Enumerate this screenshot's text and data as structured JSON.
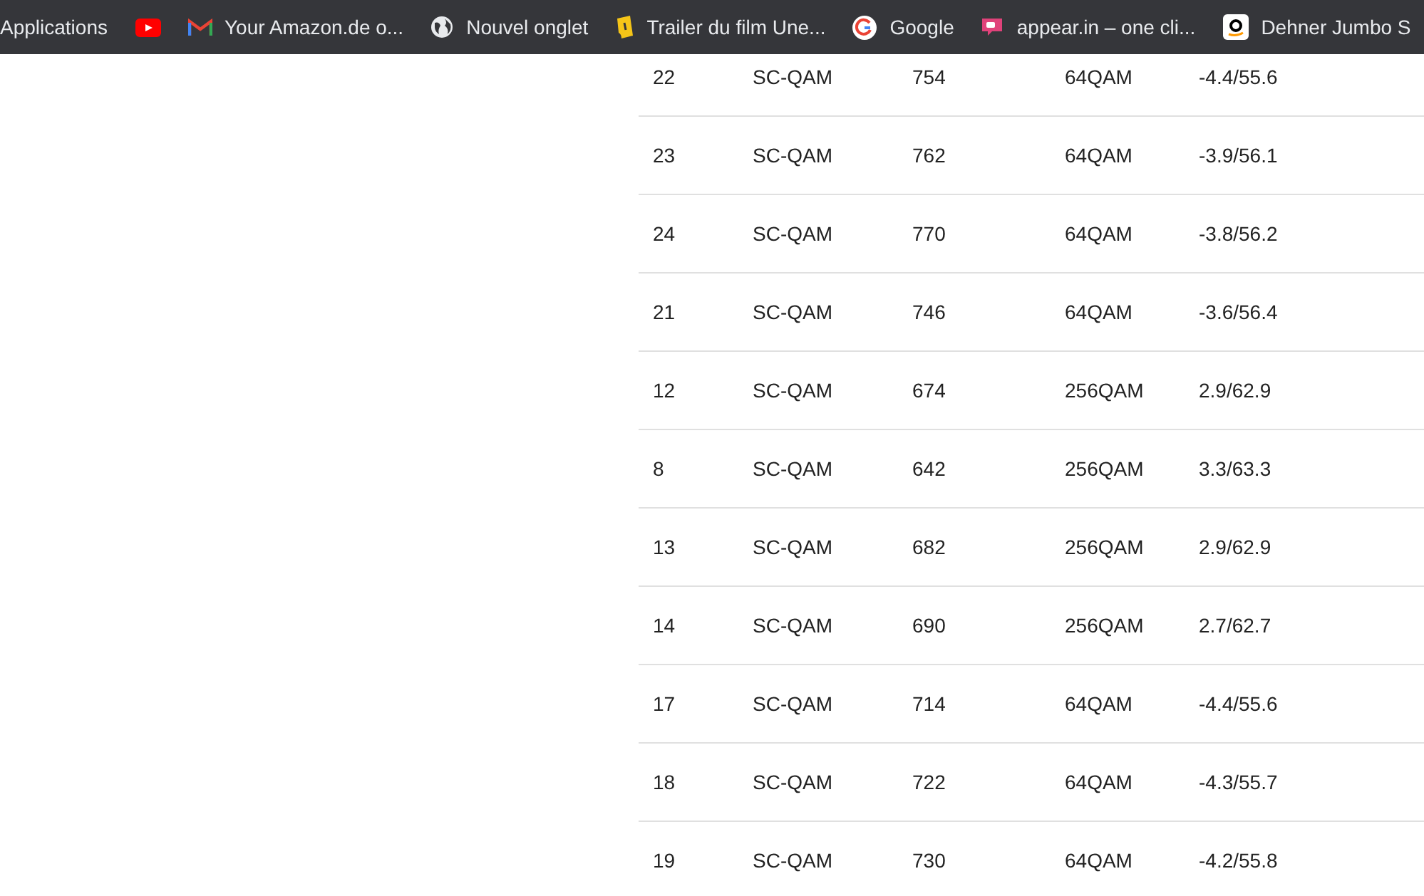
{
  "bookmarks": [
    {
      "kind": "text",
      "label": "Applications"
    },
    {
      "kind": "youtube"
    },
    {
      "kind": "gmail",
      "label": "Your Amazon.de o..."
    },
    {
      "kind": "globe",
      "label": "Nouvel onglet"
    },
    {
      "kind": "ticket",
      "label": "Trailer du film Une..."
    },
    {
      "kind": "google",
      "label": "Google"
    },
    {
      "kind": "chat",
      "label": "appear.in – one cli..."
    },
    {
      "kind": "amazon",
      "label": "Dehner Jumbo S"
    }
  ],
  "table": {
    "rows": [
      [
        "22",
        "SC-QAM",
        "754",
        "64QAM",
        "-4.4/55.6"
      ],
      [
        "23",
        "SC-QAM",
        "762",
        "64QAM",
        "-3.9/56.1"
      ],
      [
        "24",
        "SC-QAM",
        "770",
        "64QAM",
        "-3.8/56.2"
      ],
      [
        "21",
        "SC-QAM",
        "746",
        "64QAM",
        "-3.6/56.4"
      ],
      [
        "12",
        "SC-QAM",
        "674",
        "256QAM",
        "2.9/62.9"
      ],
      [
        "8",
        "SC-QAM",
        "642",
        "256QAM",
        "3.3/63.3"
      ],
      [
        "13",
        "SC-QAM",
        "682",
        "256QAM",
        "2.9/62.9"
      ],
      [
        "14",
        "SC-QAM",
        "690",
        "256QAM",
        "2.7/62.7"
      ],
      [
        "17",
        "SC-QAM",
        "714",
        "64QAM",
        "-4.4/55.6"
      ],
      [
        "18",
        "SC-QAM",
        "722",
        "64QAM",
        "-4.3/55.7"
      ],
      [
        "19",
        "SC-QAM",
        "730",
        "64QAM",
        "-4.2/55.8"
      ]
    ]
  }
}
